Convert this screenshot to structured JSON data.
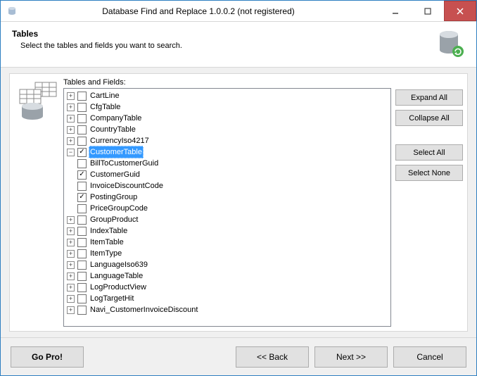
{
  "window": {
    "title": "Database Find and Replace 1.0.0.2 (not registered)"
  },
  "header": {
    "title": "Tables",
    "subtitle": "Select the tables and fields you want to search."
  },
  "treeLabel": "Tables and Fields:",
  "tree": {
    "root": [
      {
        "label": "CartLine",
        "expandable": true,
        "expanded": false,
        "checked": false
      },
      {
        "label": "CfgTable",
        "expandable": true,
        "expanded": false,
        "checked": false
      },
      {
        "label": "CompanyTable",
        "expandable": true,
        "expanded": false,
        "checked": false
      },
      {
        "label": "CountryTable",
        "expandable": true,
        "expanded": false,
        "checked": false
      },
      {
        "label": "CurrencyIso4217",
        "expandable": true,
        "expanded": false,
        "checked": false
      },
      {
        "label": "CustomerTable",
        "expandable": true,
        "expanded": true,
        "checked": true,
        "selected": true,
        "children": [
          {
            "label": "BillToCustomerGuid",
            "checked": false
          },
          {
            "label": "CustomerGuid",
            "checked": true
          },
          {
            "label": "InvoiceDiscountCode",
            "checked": false
          },
          {
            "label": "PostingGroup",
            "checked": true
          },
          {
            "label": "PriceGroupCode",
            "checked": false
          }
        ]
      },
      {
        "label": "GroupProduct",
        "expandable": true,
        "expanded": false,
        "checked": false
      },
      {
        "label": "IndexTable",
        "expandable": true,
        "expanded": false,
        "checked": false
      },
      {
        "label": "ItemTable",
        "expandable": true,
        "expanded": false,
        "checked": false
      },
      {
        "label": "ItemType",
        "expandable": true,
        "expanded": false,
        "checked": false
      },
      {
        "label": "LanguageIso639",
        "expandable": true,
        "expanded": false,
        "checked": false
      },
      {
        "label": "LanguageTable",
        "expandable": true,
        "expanded": false,
        "checked": false
      },
      {
        "label": "LogProductView",
        "expandable": true,
        "expanded": false,
        "checked": false
      },
      {
        "label": "LogTargetHit",
        "expandable": true,
        "expanded": false,
        "checked": false
      },
      {
        "label": "Navi_CustomerInvoiceDiscount",
        "expandable": true,
        "expanded": false,
        "checked": false
      }
    ]
  },
  "sideButtons": {
    "expandAll": "Expand All",
    "collapseAll": "Collapse All",
    "selectAll": "Select All",
    "selectNone": "Select None"
  },
  "footer": {
    "goPro": "Go Pro!",
    "back": "<< Back",
    "next": "Next >>",
    "cancel": "Cancel"
  }
}
